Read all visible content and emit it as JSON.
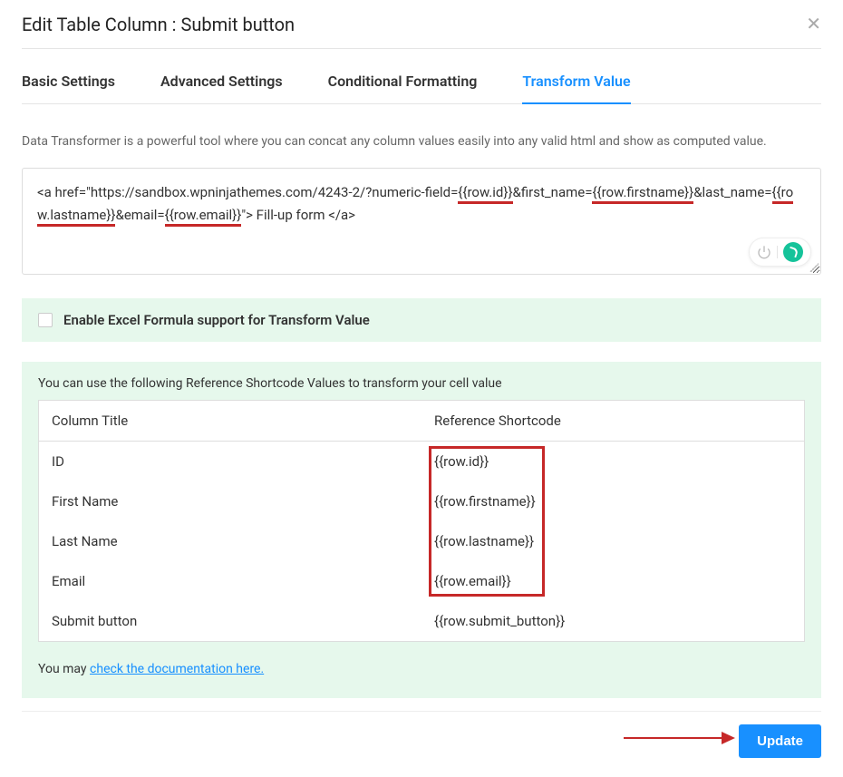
{
  "header": {
    "title": "Edit Table Column : Submit button"
  },
  "tabs": {
    "basic": "Basic Settings",
    "advanced": "Advanced Settings",
    "conditional": "Conditional Formatting",
    "transform": "Transform Value"
  },
  "description": "Data Transformer is a powerful tool where you can concat any column values easily into any valid html and show as computed value.",
  "code": {
    "p1": "<a href=\"https://sandbox.wpninjathemes.com/4243-2/?numeric-field=",
    "t1": "{{row.id}}",
    "p2": "&first_name=",
    "t2": "{{row.firstname}}",
    "p3": "&last_name=",
    "t3": "{{row.lastname}}",
    "p4": "&email=",
    "t4": "{{row.email}}",
    "p5": "\"> Fill-up form </a>"
  },
  "excel_checkbox_label": "Enable Excel Formula support for Transform Value",
  "shortcode": {
    "desc": "You can use the following Reference Shortcode Values to transform your cell value",
    "col_title": "Column Title",
    "col_ref": "Reference Shortcode",
    "rows": [
      {
        "title": "ID",
        "ref": "{{row.id}}"
      },
      {
        "title": "First Name",
        "ref": "{{row.firstname}}"
      },
      {
        "title": "Last Name",
        "ref": "{{row.lastname}}"
      },
      {
        "title": "Email",
        "ref": "{{row.email}}"
      },
      {
        "title": "Submit button",
        "ref": "{{row.submit_button}}"
      }
    ]
  },
  "doc": {
    "prefix": "You may ",
    "link": "check the documentation here."
  },
  "footer": {
    "update": "Update"
  }
}
